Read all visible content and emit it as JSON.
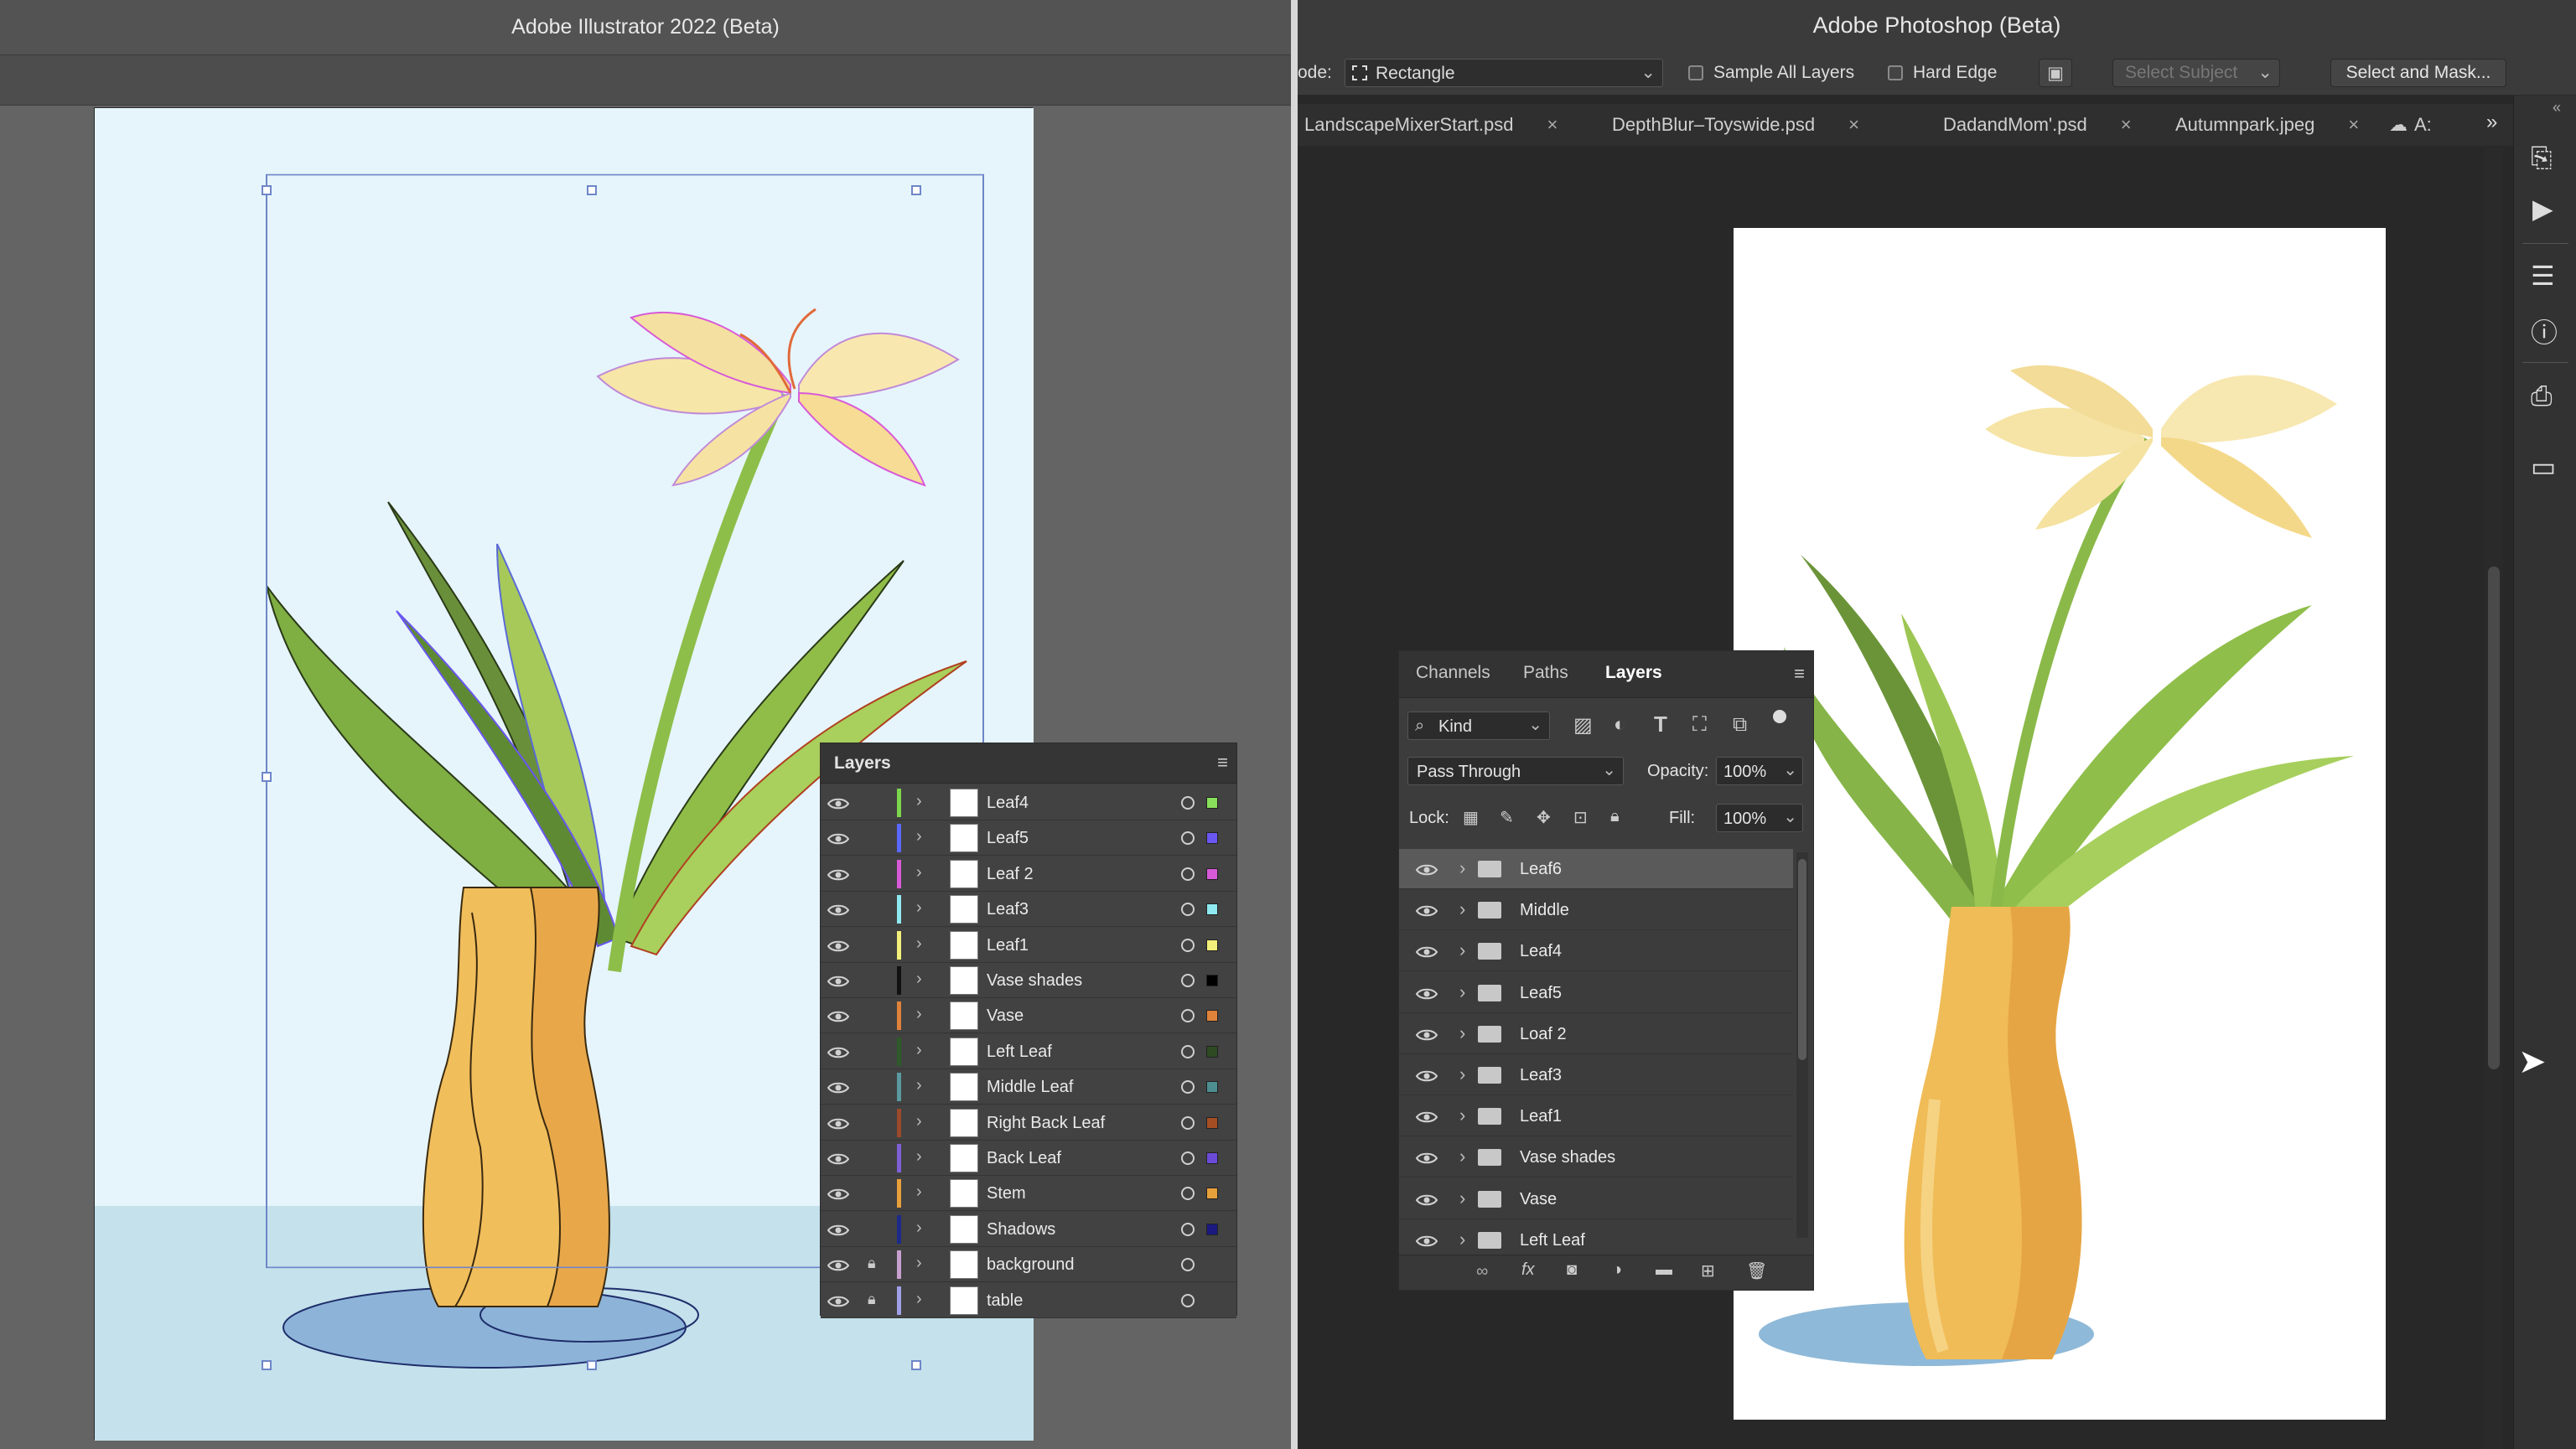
{
  "illustrator": {
    "title": "Adobe Illustrator 2022 (Beta)",
    "layers_panel": {
      "title": "Layers",
      "layers": [
        {
          "name": "Leaf4",
          "color": "#7cd64a",
          "swatch": "#89e05a",
          "locked": false
        },
        {
          "name": "Leaf5",
          "color": "#5a68ff",
          "swatch": "#6a56f0",
          "locked": false
        },
        {
          "name": "Leaf 2",
          "color": "#d85ad8",
          "swatch": "#d85ad8",
          "locked": false
        },
        {
          "name": "Leaf3",
          "color": "#8ee9f0",
          "swatch": "#8ee9f0",
          "locked": false
        },
        {
          "name": "Leaf1",
          "color": "#f2f07a",
          "swatch": "#f2f07a",
          "locked": false
        },
        {
          "name": "Vase shades",
          "color": "#111111",
          "swatch": "#000000",
          "locked": false
        },
        {
          "name": "Vase",
          "color": "#e0823a",
          "swatch": "#e0823a",
          "locked": false
        },
        {
          "name": "Left Leaf",
          "color": "#2f5a2a",
          "swatch": "#2d4a22",
          "locked": false
        },
        {
          "name": "Middle Leaf",
          "color": "#5a9aa0",
          "swatch": "#4d8f90",
          "locked": false
        },
        {
          "name": "Right Back Leaf",
          "color": "#9a4a2a",
          "swatch": "#a44f23",
          "locked": false
        },
        {
          "name": "Back Leaf",
          "color": "#8060d8",
          "swatch": "#6c4ad8",
          "locked": false
        },
        {
          "name": "Stem",
          "color": "#e8a03a",
          "swatch": "#e8a03a",
          "locked": false
        },
        {
          "name": "Shadows",
          "color": "#1c2a8a",
          "swatch": "#1a1a80",
          "locked": false
        },
        {
          "name": "background",
          "color": "#c8a0d0",
          "swatch": "",
          "locked": true
        },
        {
          "name": "table",
          "color": "#a0a0e8",
          "swatch": "",
          "locked": true
        }
      ]
    }
  },
  "photoshop": {
    "title": "Adobe Photoshop (Beta)",
    "options_bar": {
      "mode_label": "ode:",
      "mode_value": "Rectangle",
      "sample_all_layers": "Sample All Layers",
      "hard_edge": "Hard Edge",
      "select_subject": "Select Subject",
      "select_and_mask": "Select and Mask..."
    },
    "tabs": [
      "LandscapeMixerStart.psd",
      "DepthBlur–Toyswide.psd",
      "DadandMom'.psd",
      "Autumnpark.jpeg",
      "A:"
    ],
    "layers_panel": {
      "tabs": [
        "Channels",
        "Paths",
        "Layers"
      ],
      "active_tab": "Layers",
      "filter": "Kind",
      "blend_mode": "Pass Through",
      "opacity_label": "Opacity:",
      "opacity_value": "100%",
      "lock_label": "Lock:",
      "fill_label": "Fill:",
      "fill_value": "100%",
      "layers": [
        {
          "name": "Leaf6",
          "selected": true
        },
        {
          "name": "Middle",
          "selected": false
        },
        {
          "name": "Leaf4",
          "selected": false
        },
        {
          "name": "Leaf5",
          "selected": false
        },
        {
          "name": "Loaf 2",
          "selected": false
        },
        {
          "name": "Leaf3",
          "selected": false
        },
        {
          "name": "Leaf1",
          "selected": false
        },
        {
          "name": "Vase shades",
          "selected": false
        },
        {
          "name": "Vase",
          "selected": false
        },
        {
          "name": "Left Leaf",
          "selected": false
        }
      ]
    }
  }
}
